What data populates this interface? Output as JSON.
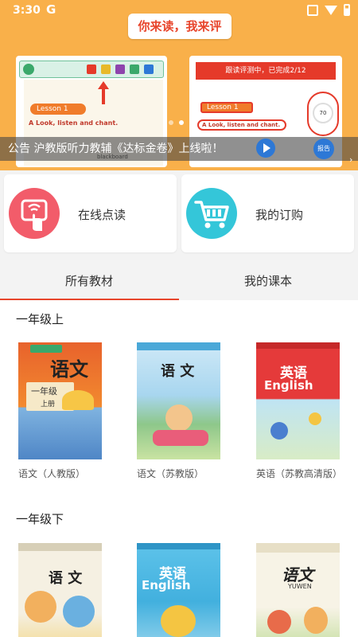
{
  "status_bar": {
    "time": "3:30",
    "g_label": "G"
  },
  "banner": {
    "title": "你来读，我来评",
    "left_slide": {
      "lesson": "Lesson 1",
      "look_text": "A Look, listen and chant.",
      "board_label": "blackboard",
      "on_label": "on"
    },
    "right_slide": {
      "status": "跟读评测中，已完成2/12",
      "lesson": "Lesson 1",
      "look_text": "A Look, listen and chant.",
      "score": "70"
    },
    "notice": "公告  沪教版听力教辅《达标金卷》上线啦！",
    "report_label": "报告",
    "chevron": "›"
  },
  "cards": [
    {
      "label": "在线点读",
      "icon": "touch-reading-icon",
      "color": "#f25c6a"
    },
    {
      "label": "我的订购",
      "icon": "shopping-cart-icon",
      "color": "#34c6d9"
    }
  ],
  "tabs": [
    {
      "label": "所有教材",
      "active": true
    },
    {
      "label": "我的课本",
      "active": false
    }
  ],
  "accent_color": "#e8452c",
  "sections": [
    {
      "title": "一年级上",
      "books": [
        {
          "name": "语文（人教版）",
          "cover_title": "语文",
          "cover_sub": "一年级",
          "cover_sub2": "上册"
        },
        {
          "name": "语文（苏教版）",
          "cover_title": "语 文"
        },
        {
          "name": "英语（苏教高清版）",
          "cover_title": "英语",
          "cover_en": "English"
        }
      ]
    },
    {
      "title": "一年级下",
      "books": [
        {
          "name": "",
          "cover_title": "语 文"
        },
        {
          "name": "",
          "cover_title": "英语",
          "cover_en": "English"
        },
        {
          "name": "",
          "cover_title": "语文",
          "cover_en": "YUWEN"
        }
      ]
    }
  ]
}
